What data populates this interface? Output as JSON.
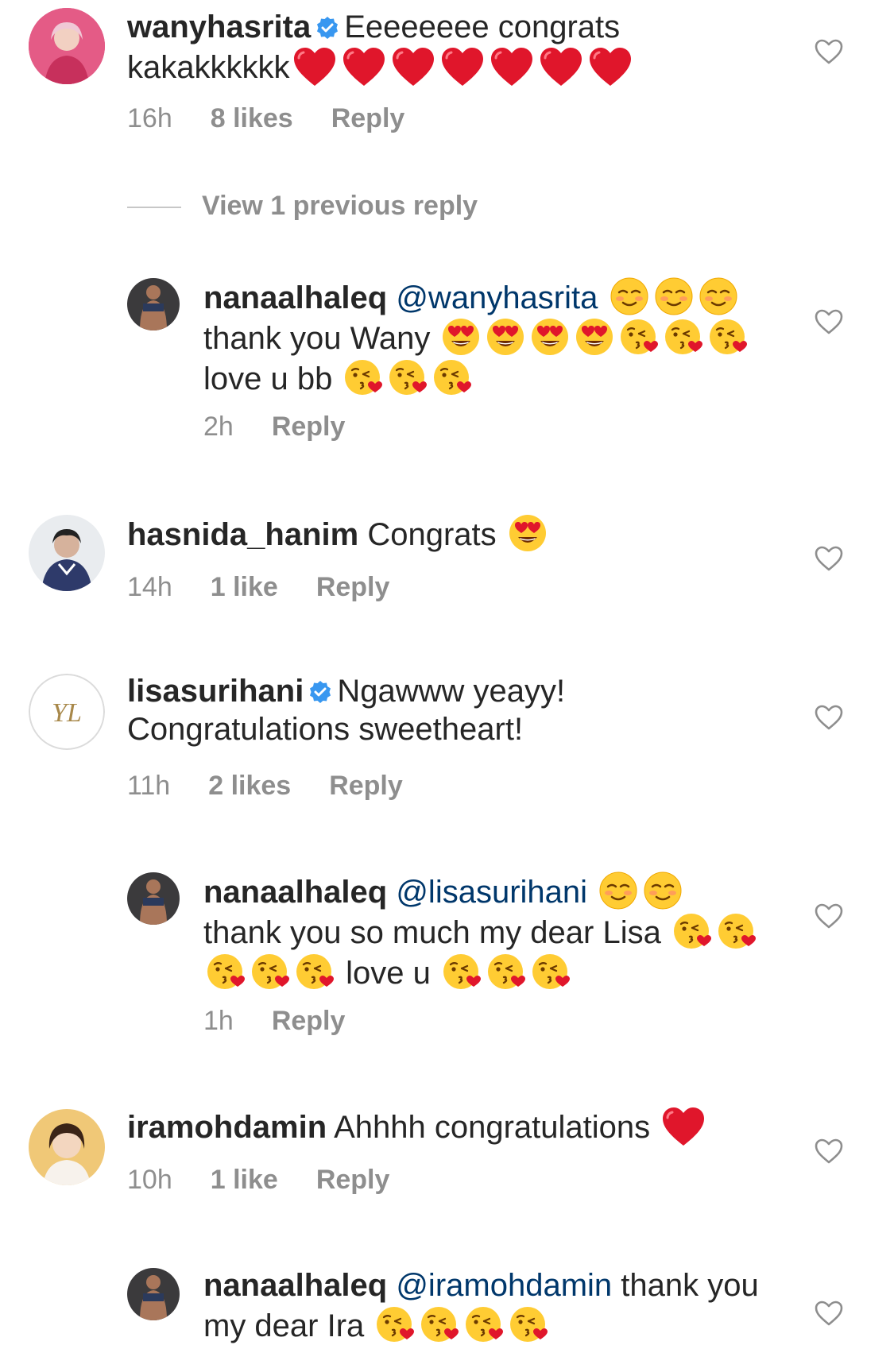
{
  "comments": [
    {
      "username": "wanyhasrita",
      "verified": true,
      "text_before": "Eeeeeeee congrats kakakkkkkk",
      "time": "16h",
      "likes": "8 likes",
      "reply_label": "Reply",
      "avatar_color": "#d94f7a",
      "view_previous": "View 1 previous reply",
      "replies": [
        {
          "username": "nanaalhaleq",
          "mention": "@wanyhasrita",
          "text1": "thank you Wany",
          "text2": "love u bb",
          "time": "2h",
          "reply_label": "Reply"
        }
      ]
    },
    {
      "username": "hasnida_hanim",
      "text": "Congrats",
      "time": "14h",
      "likes": "1 like",
      "reply_label": "Reply",
      "avatar_color": "#3a4a78"
    },
    {
      "username": "lisasurihani",
      "verified": true,
      "text": "Ngawww yeayy! Congratulations sweetheart!",
      "time": "11h",
      "likes": "2 likes",
      "reply_label": "Reply",
      "avatar_monogram": "YL",
      "replies": [
        {
          "username": "nanaalhaleq",
          "mention": "@lisasurihani",
          "text1": "thank you so much my dear Lisa",
          "text2": "love u",
          "time": "1h",
          "reply_label": "Reply"
        }
      ]
    },
    {
      "username": "iramohdamin",
      "text": "Ahhhh congratulations",
      "time": "10h",
      "likes": "1 like",
      "reply_label": "Reply",
      "avatar_color": "#e8b86a",
      "replies": [
        {
          "username": "nanaalhaleq",
          "mention": "@iramohdamin",
          "text1": "thank you my dear Ira"
        }
      ]
    }
  ],
  "colors": {
    "text": "#262626",
    "muted": "#8e8e8e",
    "mention": "#00376b",
    "verified": "#3897f0",
    "heart": "#e0162b"
  },
  "icons": {
    "like": "heart-outline-icon",
    "verified": "verified-badge-icon"
  }
}
